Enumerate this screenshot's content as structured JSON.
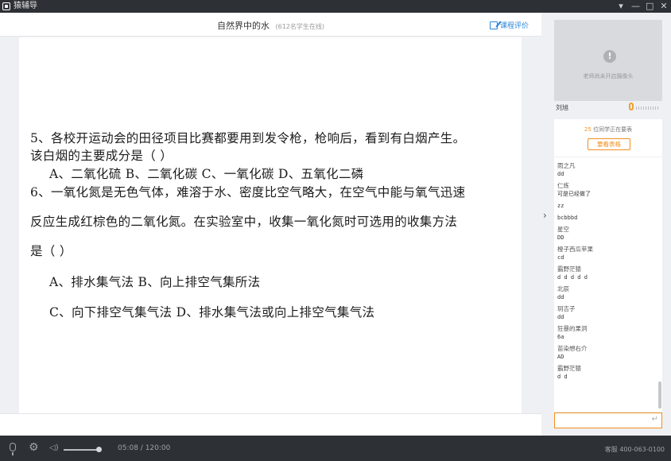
{
  "window": {
    "app_name": "猿辅导",
    "controls": [
      "▾",
      "—",
      "□",
      "✕"
    ]
  },
  "header": {
    "course_title": "自然界中的水",
    "online": "(612名学生在线)",
    "rate_label": "课程评价"
  },
  "slide": {
    "lines": [
      "5、各校开运动会的田径项目比赛都要用到发令枪，枪响后，看到有白烟产生。",
      "该白烟的主要成分是（      ）",
      "A、二氧化硫        B、二氧化碳        C、一氧化碳        D、五氧化二磷",
      "6、一氧化氮是无色气体，难溶于水、密度比空气略大，在空气中能与氧气迅速",
      "反应生成红棕色的二氧化氮。在实验室中，收集一氧化氮时可选用的收集方法",
      "是（      ）",
      "A、排水集气法                     B、向上排空气集所法",
      "C、向下排空气集气法              D、排水集气法或向上排空气集气法"
    ]
  },
  "collapse_arrow": "›",
  "camera": {
    "icon": "!",
    "status_text": "老师尚未开启摄像头"
  },
  "teacher": {
    "name": "刘旭"
  },
  "chat": {
    "notice_count": "25",
    "notice_text": " 位同学正在要表",
    "view_button": "要看表格",
    "messages": [
      {
        "user": "雨之凡",
        "text": "dd"
      },
      {
        "user": "仁炼",
        "text": "可是已经做了"
      },
      {
        "user": "",
        "text": "zz"
      },
      {
        "user": "",
        "text": "bcbbbd"
      },
      {
        "user": "星空",
        "text": "DD"
      },
      {
        "user": "橙子西瓜苹果",
        "text": "cd"
      },
      {
        "user": "霸野茫猿",
        "text": "d d d d d"
      },
      {
        "user": "北辰",
        "text": "dd"
      },
      {
        "user": "玥吉子",
        "text": "dd"
      },
      {
        "user": "狂暴的果泂",
        "text": "6a"
      },
      {
        "user": "苗染想右介",
        "text": "AD"
      },
      {
        "user": "霸野茫猿",
        "text": "d d"
      }
    ],
    "input_placeholder": "",
    "send_icon": "↵"
  },
  "player": {
    "time": "05:08 / 120:00",
    "service": "客服 400-063-0100",
    "volume_level": 0.95
  },
  "colors": {
    "accent": "#f09020",
    "link": "#2a86d8",
    "titlebar": "#2d3035"
  }
}
